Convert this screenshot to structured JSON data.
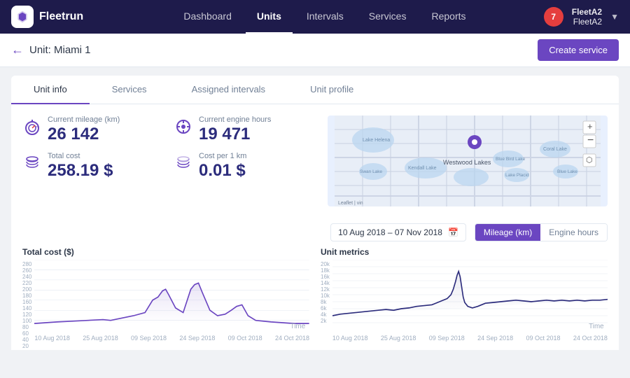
{
  "header": {
    "logo_text": "Fleetrun",
    "nav_items": [
      {
        "label": "Dashboard",
        "active": false
      },
      {
        "label": "Units",
        "active": true
      },
      {
        "label": "Intervals",
        "active": false
      },
      {
        "label": "Services",
        "active": false
      },
      {
        "label": "Reports",
        "active": false
      }
    ],
    "notification_count": "7",
    "user": {
      "fleet": "FleetA2",
      "sub": "FleetA2"
    }
  },
  "subheader": {
    "unit_label": "Unit: Miami 1",
    "create_button": "Create service"
  },
  "tabs": [
    {
      "label": "Unit info",
      "active": true
    },
    {
      "label": "Services",
      "active": false
    },
    {
      "label": "Assigned intervals",
      "active": false
    },
    {
      "label": "Unit profile",
      "active": false
    }
  ],
  "stats": {
    "mileage_label": "Current mileage (km)",
    "mileage_value": "26 142",
    "engine_label": "Current engine hours",
    "engine_value": "19 471",
    "cost_label": "Total cost",
    "cost_value": "258.19 $",
    "cost_per_km_label": "Cost per 1 km",
    "cost_per_km_value": "0.01 $"
  },
  "date_range": {
    "value": "10 Aug 2018 – 07 Nov 2018"
  },
  "metric_toggle": {
    "option1": "Mileage (km)",
    "option2": "Engine hours"
  },
  "charts": {
    "total_cost_title": "Total cost ($)",
    "unit_metrics_title": "Unit metrics",
    "x_labels_cost": [
      "10 Aug 2018",
      "25 Aug 2018",
      "09 Sep 2018",
      "24 Sep 2018",
      "09 Oct 2018",
      "24 Oct 2018"
    ],
    "x_labels_metrics": [
      "10 Aug 2018",
      "25 Aug 2018",
      "09 Sep 2018",
      "24 Sep 2018",
      "09 Oct 2018",
      "24 Oct 2018"
    ],
    "y_labels_cost": [
      "280",
      "260",
      "240",
      "220",
      "200",
      "180",
      "160",
      "140",
      "120",
      "100",
      "80",
      "60",
      "40",
      "20"
    ],
    "y_labels_metrics": [
      "20k",
      "18k",
      "16k",
      "14k",
      "12k",
      "10k",
      "8k",
      "6k",
      "4k",
      "2k"
    ],
    "time_label": "Time"
  }
}
